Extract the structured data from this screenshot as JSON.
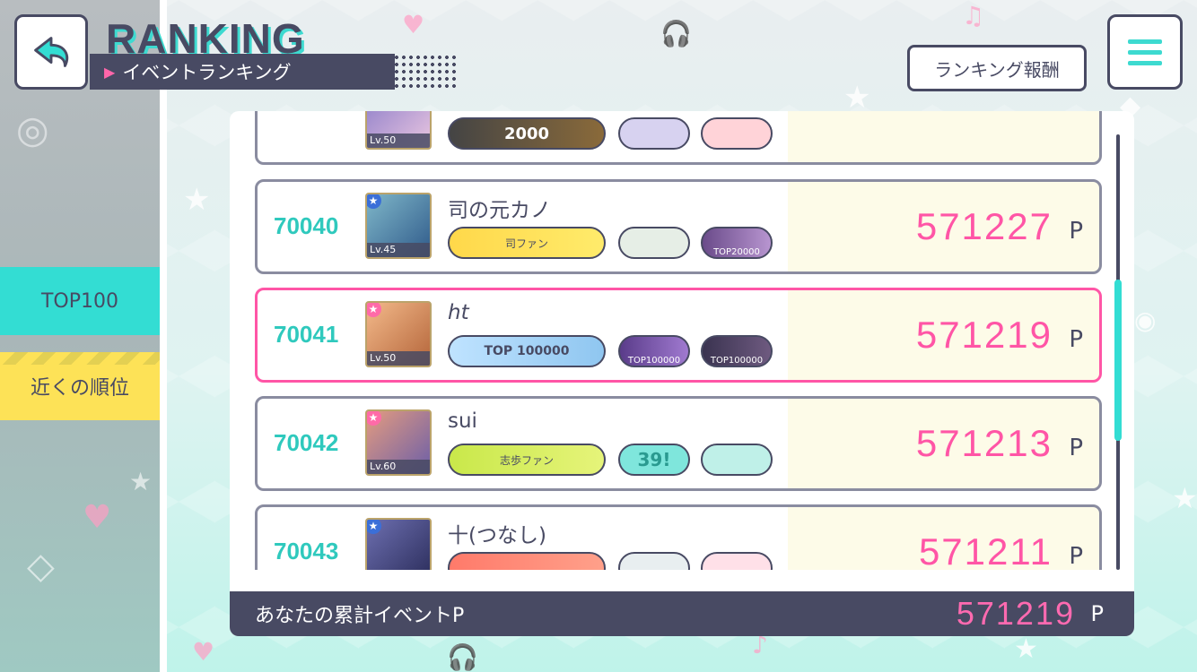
{
  "header": {
    "title": "RANKING",
    "subtitle": "イベントランキング",
    "reward_button": "ランキング報酬"
  },
  "sidebar": {
    "tabs": [
      {
        "label": "TOP100",
        "active": true
      },
      {
        "label": "近くの順位",
        "active": false
      }
    ]
  },
  "rows": [
    {
      "rank": "",
      "name": "",
      "level": "Lv.50",
      "score": "",
      "unit": "",
      "badges": [
        "2000",
        "",
        ""
      ],
      "highlight": false
    },
    {
      "rank": "70040",
      "name": "司の元カノ",
      "level": "Lv.45",
      "score": "571227",
      "unit": "P",
      "badges": [
        "司ファン",
        "",
        "TOP20000"
      ],
      "highlight": false
    },
    {
      "rank": "70041",
      "name": "ht",
      "level": "Lv.50",
      "score": "571219",
      "unit": "P",
      "badges": [
        "TOP 100000",
        "TOP100000",
        "TOP100000"
      ],
      "highlight": true
    },
    {
      "rank": "70042",
      "name": "sui",
      "level": "Lv.60",
      "score": "571213",
      "unit": "P",
      "badges": [
        "志歩ファン",
        "39!",
        ""
      ],
      "highlight": false
    },
    {
      "rank": "70043",
      "name": "十(つなし)",
      "level": "",
      "score": "571211",
      "unit": "P",
      "badges": [
        "",
        "",
        ""
      ],
      "highlight": false
    }
  ],
  "footer": {
    "label": "あなたの累計イベントP",
    "value": "571219",
    "unit": "P"
  },
  "colors": {
    "accent": "#33ddd3",
    "score_pink": "#ff55a6",
    "navy": "#484a63",
    "yellow": "#fde257"
  }
}
